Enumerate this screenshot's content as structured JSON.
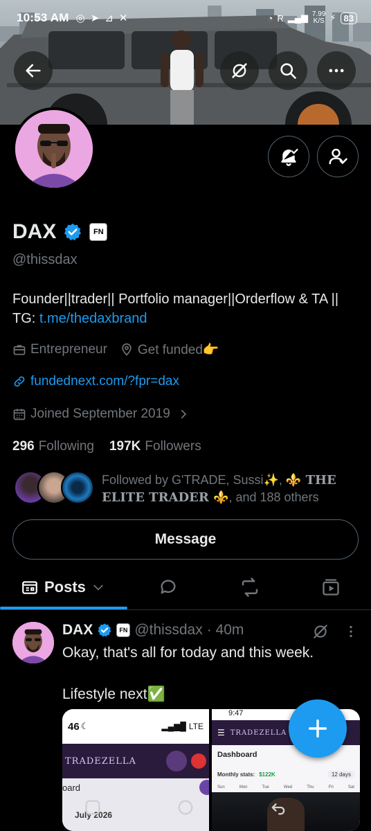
{
  "status_bar": {
    "time": "10:53 AM",
    "net_speed": "7.99",
    "net_unit": "K/S",
    "battery": "83",
    "signal_r": "R"
  },
  "profile": {
    "name": "DAX",
    "badge_text": "FN",
    "handle": "@thissdax",
    "bio_text": "Founder||trader|| Portfolio manager||Orderflow & TA || TG: ",
    "bio_link": "t.me/thedaxbrand",
    "category": "Entrepreneur",
    "location": "Get funded👉",
    "website": "fundednext.com/?fpr=dax",
    "joined": "Joined September 2019",
    "following_count": "296",
    "following_label": "Following",
    "followers_count": "197K",
    "followers_label": "Followers",
    "followed_by_prefix": "Followed by G'TRADE, Sussi✨, ",
    "followed_by_serif": "⚜️ THE ELITE TRADER ⚜️",
    "followed_by_suffix": ", and 188 others"
  },
  "buttons": {
    "message": "Message"
  },
  "tabs": {
    "posts": "Posts"
  },
  "post": {
    "name": "DAX",
    "badge_text": "FN",
    "handle": "@thissdax",
    "time": "· 40m",
    "text": "Okay, that's all for today and this week.\n\nLifestyle next✅",
    "media_left": {
      "status_time": "46",
      "status_net": "LTE",
      "brand": "TRADEZELLA",
      "section": "oard",
      "month": "July 2026"
    },
    "media_right": {
      "status_time": "9:47",
      "brand": "TRADEZELLA",
      "title": "Dashboard",
      "stat_label": "Monthly stats:",
      "stat_value": "$122K",
      "days": "12 days",
      "weekdays": [
        "Sun",
        "Mon",
        "Tue",
        "Wed",
        "Thu",
        "Fri",
        "Sat"
      ]
    }
  },
  "colors": {
    "accent": "#1d9bf0",
    "muted": "#71767b",
    "text": "#e7e9ea",
    "border": "#536471"
  }
}
